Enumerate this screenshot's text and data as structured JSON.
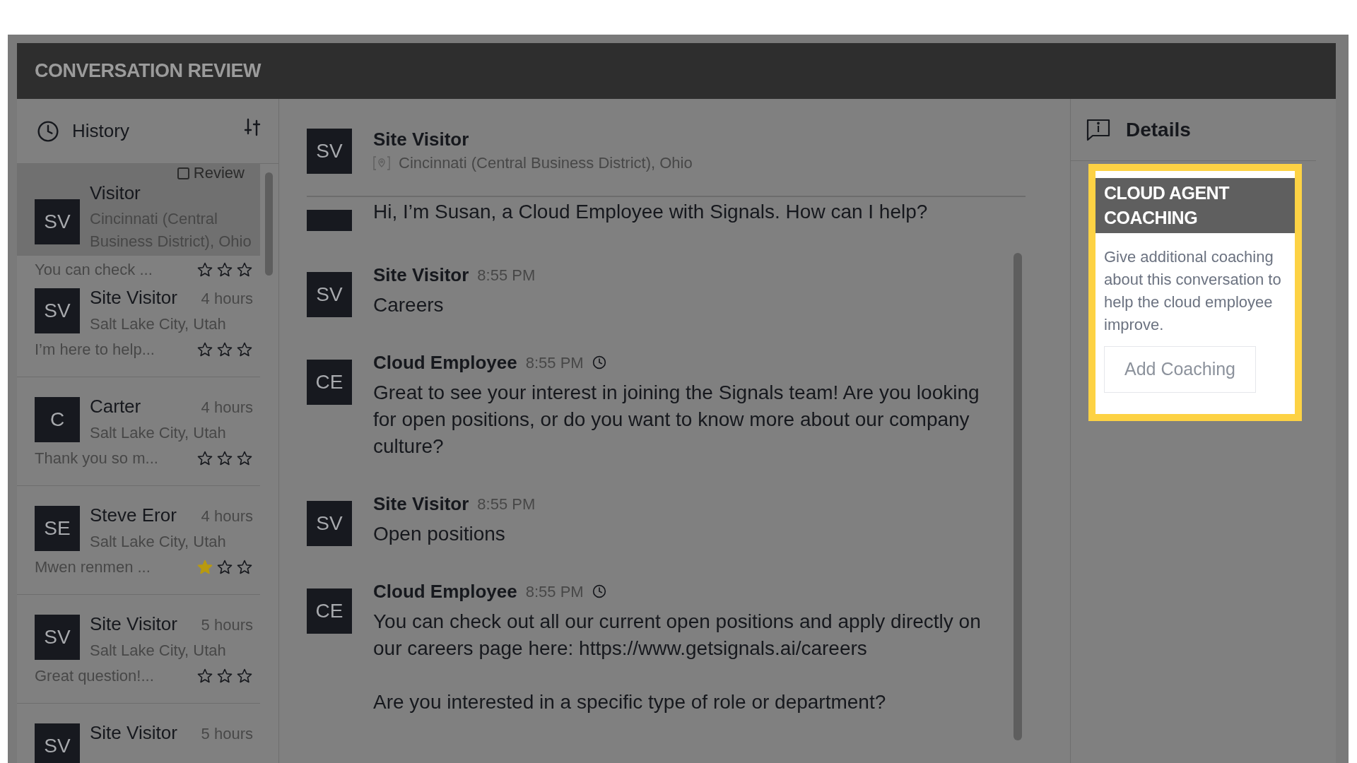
{
  "header": {
    "title": "CONVERSATION REVIEW"
  },
  "history": {
    "title": "History",
    "items": [
      {
        "initials": "SV",
        "name": "Visitor",
        "location": "Cincinnati (Central Business District), Ohio",
        "preview": "You can check ...",
        "stars": 0,
        "selected": true,
        "review": {
          "label": "Review",
          "checked": false
        }
      },
      {
        "initials": "SV",
        "name": "Site Visitor",
        "time": "4 hours",
        "location": "Salt Lake City, Utah",
        "preview": "I’m here to help...",
        "stars": 0,
        "selected": false
      },
      {
        "initials": "C",
        "name": "Carter",
        "time": "4 hours",
        "location": "Salt Lake City, Utah",
        "preview": "Thank you so m...",
        "stars": 0,
        "selected": false
      },
      {
        "initials": "SE",
        "name": "Steve Eror",
        "time": "4 hours",
        "location": "Salt Lake City, Utah",
        "preview": "Mwen renmen ...",
        "stars": 1,
        "selected": false
      },
      {
        "initials": "SV",
        "name": "Site Visitor",
        "time": "5 hours",
        "location": "Salt Lake City, Utah",
        "preview": "Great question!...",
        "stars": 0,
        "selected": false
      },
      {
        "initials": "SV",
        "name": "Site Visitor",
        "time": "5 hours",
        "selected": false
      }
    ]
  },
  "conversation": {
    "contact": {
      "initials": "SV",
      "name": "Site Visitor",
      "location": "Cincinnati (Central Business District), Ohio"
    },
    "messages": [
      {
        "kind": "cut",
        "paragraphs": [
          "Hi, I’m Susan, a Cloud Employee with Signals. How can I help?"
        ]
      },
      {
        "kind": "visitor",
        "initials": "SV",
        "sender": "Site Visitor",
        "time": "8:55 PM",
        "paragraphs": [
          "Careers"
        ]
      },
      {
        "kind": "employee",
        "initials": "CE",
        "sender": "Cloud Employee",
        "time": "8:55 PM",
        "paragraphs": [
          "Great to see your interest in joining the Signals team! Are you looking for open positions, or do you want to know more about our company culture?"
        ]
      },
      {
        "kind": "visitor",
        "initials": "SV",
        "sender": "Site Visitor",
        "time": "8:55 PM",
        "paragraphs": [
          "Open positions"
        ]
      },
      {
        "kind": "employee",
        "initials": "CE",
        "sender": "Cloud Employee",
        "time": "8:55 PM",
        "paragraphs": [
          "You can check out all our current open positions and apply directly on our careers page here: https://www.getsignals.ai/careers",
          "Are you interested in a specific type of role or department?"
        ]
      }
    ]
  },
  "details": {
    "title": "Details",
    "card": {
      "title": "CLOUD AGENT COACHING",
      "description": "Give additional coaching about this conversation to help the cloud employee improve.",
      "button": "Add Coaching"
    }
  }
}
